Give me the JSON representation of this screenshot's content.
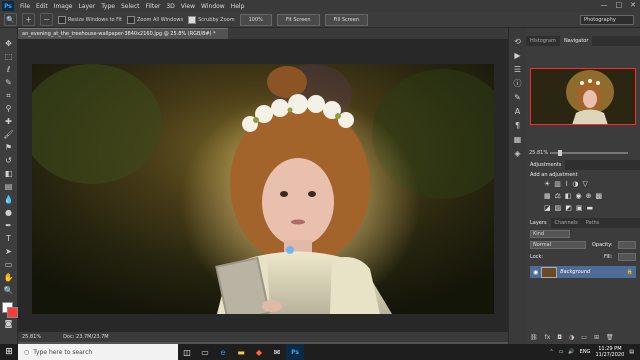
{
  "app": {
    "logo_text": "Ps"
  },
  "menu": [
    "File",
    "Edit",
    "Image",
    "Layer",
    "Type",
    "Select",
    "Filter",
    "3D",
    "View",
    "Window",
    "Help"
  ],
  "window_controls": [
    "—",
    "□",
    "✕"
  ],
  "options_bar": {
    "resize_windows_label": "Resize Windows to Fit",
    "resize_windows_checked": false,
    "zoom_all_label": "Zoom All Windows",
    "zoom_all_checked": false,
    "scrubby_zoom_label": "Scrubby Zoom",
    "scrubby_zoom_checked": true,
    "actual_pixels_button": "100%",
    "fit_screen_button": "Fit Screen",
    "fill_screen_button": "Fill Screen",
    "workspace_value": "Photography"
  },
  "document": {
    "tab_title": "an_evening_at_the_treehouse-wallpaper-3840x2160.jpg @ 25.8% (RGB/8#) *",
    "zoom_status": "25.81%",
    "doc_size": "Doc: 23.7M/23.7M"
  },
  "panels": {
    "top_tabs": [
      "Histogram",
      "Navigator"
    ],
    "navigator_zoom": "25.81%",
    "adjustments_tab": "Adjustments",
    "add_adjustment_label": "Add an adjustment",
    "layers_tabs": [
      "Layers",
      "Channels",
      "Paths"
    ],
    "kind_value": "Kind",
    "blend_mode": "Normal",
    "opacity_label": "Opacity:",
    "lock_label": "Lock:",
    "fill_label": "Fill:",
    "layer_name": "Background"
  },
  "taskbar": {
    "search_placeholder": "Type here to search",
    "language": "ENG",
    "time": "11:29 PM",
    "date": "11/27/2020"
  }
}
